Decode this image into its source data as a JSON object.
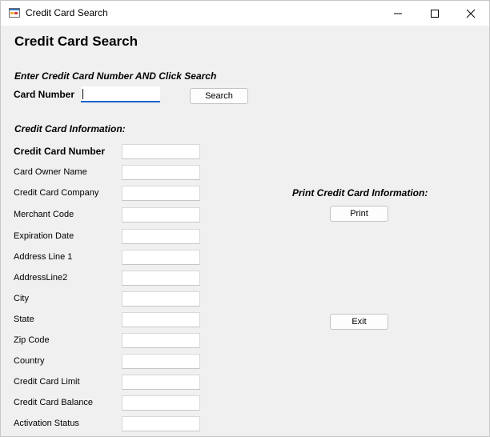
{
  "window": {
    "title": "Credit Card Search"
  },
  "heading": "Credit Card Search",
  "search": {
    "instruction": "Enter Credit Card Number AND Click Search",
    "card_number_label": "Card Number",
    "card_number_value": "",
    "button_label": "Search"
  },
  "info": {
    "section_title": "Credit Card Information:",
    "fields": [
      {
        "label": "Credit Card Number",
        "value": ""
      },
      {
        "label": "Card Owner Name",
        "value": ""
      },
      {
        "label": "Credit Card Company",
        "value": ""
      },
      {
        "label": "Merchant Code",
        "value": ""
      },
      {
        "label": "Expiration Date",
        "value": ""
      },
      {
        "label": "Address Line 1",
        "value": ""
      },
      {
        "label": "AddressLine2",
        "value": ""
      },
      {
        "label": "City",
        "value": ""
      },
      {
        "label": "State",
        "value": ""
      },
      {
        "label": "Zip Code",
        "value": ""
      },
      {
        "label": "Country",
        "value": ""
      },
      {
        "label": "Credit Card Limit",
        "value": ""
      },
      {
        "label": "Credit Card Balance",
        "value": ""
      },
      {
        "label": "Activation Status",
        "value": ""
      }
    ]
  },
  "print": {
    "section_title": "Print Credit Card Information:",
    "button_label": "Print"
  },
  "exit": {
    "button_label": "Exit"
  }
}
